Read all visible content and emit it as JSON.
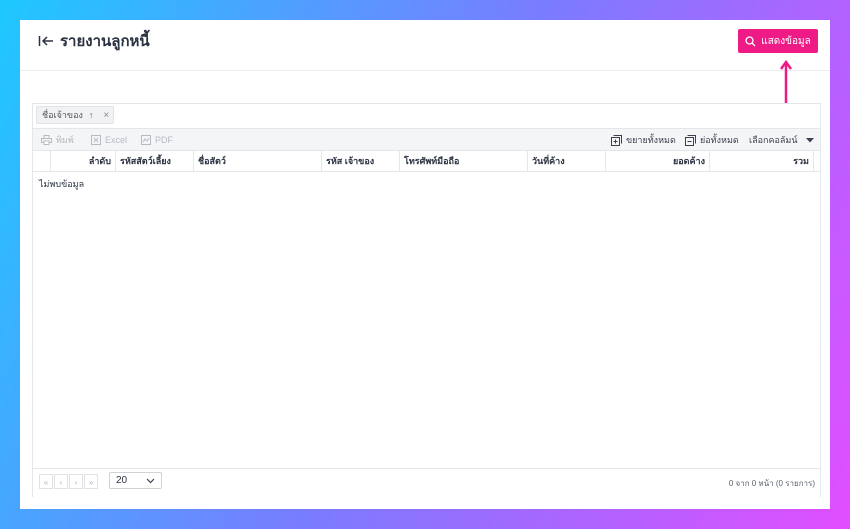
{
  "header": {
    "title": "รายงานลูกหนี้",
    "show_button_label": "แสดงข้อมูล"
  },
  "colors": {
    "accent": "#ee1b86",
    "background_start": "#1ec8ff",
    "background_end": "#e14dff"
  },
  "group_panel": {
    "chip_label": "ชื่อเจ้าของ"
  },
  "toolbar": {
    "print_label": "พิมพ์",
    "excel_label": "Excel",
    "pdf_label": "PDF",
    "expand_all_label": "ขยายทั้งหมด",
    "collapse_all_label": "ย่อทั้งหมด",
    "choose_columns_label": "เลือกคอลัมน์"
  },
  "table": {
    "columns": [
      "ลำดับ",
      "รหัสสัตว์เลี้ยง",
      "ชื่อสัตว์",
      "รหัส เจ้าของ",
      "โทรศัพท์มือถือ",
      "วันที่ค้าง",
      "ยอดค้าง",
      "รวม"
    ],
    "empty_text": "ไม่พบข้อมูล"
  },
  "footer": {
    "page_size": "20",
    "page_info": "0 จาก 0 หน้า (0 รายการ)"
  }
}
